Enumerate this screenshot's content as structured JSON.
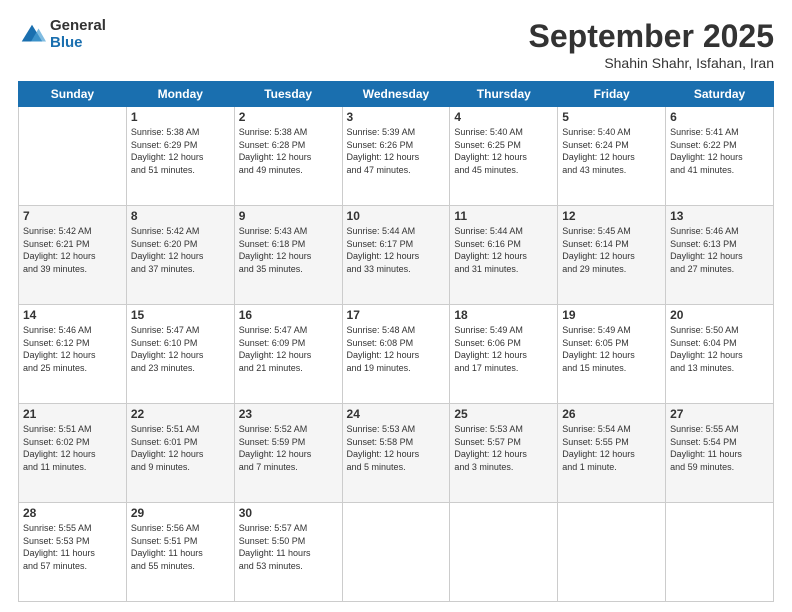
{
  "logo": {
    "general": "General",
    "blue": "Blue"
  },
  "header": {
    "month": "September 2025",
    "location": "Shahin Shahr, Isfahan, Iran"
  },
  "weekdays": [
    "Sunday",
    "Monday",
    "Tuesday",
    "Wednesday",
    "Thursday",
    "Friday",
    "Saturday"
  ],
  "weeks": [
    [
      {
        "day": "",
        "info": ""
      },
      {
        "day": "1",
        "info": "Sunrise: 5:38 AM\nSunset: 6:29 PM\nDaylight: 12 hours\nand 51 minutes."
      },
      {
        "day": "2",
        "info": "Sunrise: 5:38 AM\nSunset: 6:28 PM\nDaylight: 12 hours\nand 49 minutes."
      },
      {
        "day": "3",
        "info": "Sunrise: 5:39 AM\nSunset: 6:26 PM\nDaylight: 12 hours\nand 47 minutes."
      },
      {
        "day": "4",
        "info": "Sunrise: 5:40 AM\nSunset: 6:25 PM\nDaylight: 12 hours\nand 45 minutes."
      },
      {
        "day": "5",
        "info": "Sunrise: 5:40 AM\nSunset: 6:24 PM\nDaylight: 12 hours\nand 43 minutes."
      },
      {
        "day": "6",
        "info": "Sunrise: 5:41 AM\nSunset: 6:22 PM\nDaylight: 12 hours\nand 41 minutes."
      }
    ],
    [
      {
        "day": "7",
        "info": "Sunrise: 5:42 AM\nSunset: 6:21 PM\nDaylight: 12 hours\nand 39 minutes."
      },
      {
        "day": "8",
        "info": "Sunrise: 5:42 AM\nSunset: 6:20 PM\nDaylight: 12 hours\nand 37 minutes."
      },
      {
        "day": "9",
        "info": "Sunrise: 5:43 AM\nSunset: 6:18 PM\nDaylight: 12 hours\nand 35 minutes."
      },
      {
        "day": "10",
        "info": "Sunrise: 5:44 AM\nSunset: 6:17 PM\nDaylight: 12 hours\nand 33 minutes."
      },
      {
        "day": "11",
        "info": "Sunrise: 5:44 AM\nSunset: 6:16 PM\nDaylight: 12 hours\nand 31 minutes."
      },
      {
        "day": "12",
        "info": "Sunrise: 5:45 AM\nSunset: 6:14 PM\nDaylight: 12 hours\nand 29 minutes."
      },
      {
        "day": "13",
        "info": "Sunrise: 5:46 AM\nSunset: 6:13 PM\nDaylight: 12 hours\nand 27 minutes."
      }
    ],
    [
      {
        "day": "14",
        "info": "Sunrise: 5:46 AM\nSunset: 6:12 PM\nDaylight: 12 hours\nand 25 minutes."
      },
      {
        "day": "15",
        "info": "Sunrise: 5:47 AM\nSunset: 6:10 PM\nDaylight: 12 hours\nand 23 minutes."
      },
      {
        "day": "16",
        "info": "Sunrise: 5:47 AM\nSunset: 6:09 PM\nDaylight: 12 hours\nand 21 minutes."
      },
      {
        "day": "17",
        "info": "Sunrise: 5:48 AM\nSunset: 6:08 PM\nDaylight: 12 hours\nand 19 minutes."
      },
      {
        "day": "18",
        "info": "Sunrise: 5:49 AM\nSunset: 6:06 PM\nDaylight: 12 hours\nand 17 minutes."
      },
      {
        "day": "19",
        "info": "Sunrise: 5:49 AM\nSunset: 6:05 PM\nDaylight: 12 hours\nand 15 minutes."
      },
      {
        "day": "20",
        "info": "Sunrise: 5:50 AM\nSunset: 6:04 PM\nDaylight: 12 hours\nand 13 minutes."
      }
    ],
    [
      {
        "day": "21",
        "info": "Sunrise: 5:51 AM\nSunset: 6:02 PM\nDaylight: 12 hours\nand 11 minutes."
      },
      {
        "day": "22",
        "info": "Sunrise: 5:51 AM\nSunset: 6:01 PM\nDaylight: 12 hours\nand 9 minutes."
      },
      {
        "day": "23",
        "info": "Sunrise: 5:52 AM\nSunset: 5:59 PM\nDaylight: 12 hours\nand 7 minutes."
      },
      {
        "day": "24",
        "info": "Sunrise: 5:53 AM\nSunset: 5:58 PM\nDaylight: 12 hours\nand 5 minutes."
      },
      {
        "day": "25",
        "info": "Sunrise: 5:53 AM\nSunset: 5:57 PM\nDaylight: 12 hours\nand 3 minutes."
      },
      {
        "day": "26",
        "info": "Sunrise: 5:54 AM\nSunset: 5:55 PM\nDaylight: 12 hours\nand 1 minute."
      },
      {
        "day": "27",
        "info": "Sunrise: 5:55 AM\nSunset: 5:54 PM\nDaylight: 11 hours\nand 59 minutes."
      }
    ],
    [
      {
        "day": "28",
        "info": "Sunrise: 5:55 AM\nSunset: 5:53 PM\nDaylight: 11 hours\nand 57 minutes."
      },
      {
        "day": "29",
        "info": "Sunrise: 5:56 AM\nSunset: 5:51 PM\nDaylight: 11 hours\nand 55 minutes."
      },
      {
        "day": "30",
        "info": "Sunrise: 5:57 AM\nSunset: 5:50 PM\nDaylight: 11 hours\nand 53 minutes."
      },
      {
        "day": "",
        "info": ""
      },
      {
        "day": "",
        "info": ""
      },
      {
        "day": "",
        "info": ""
      },
      {
        "day": "",
        "info": ""
      }
    ]
  ]
}
